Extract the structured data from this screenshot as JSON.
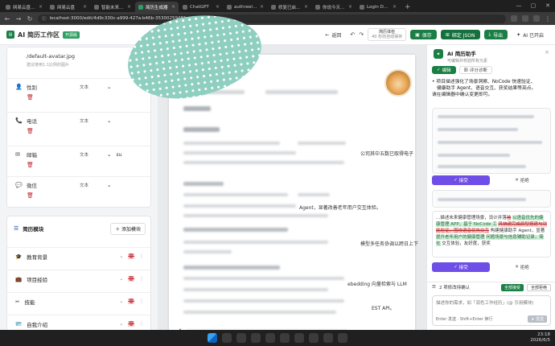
{
  "browser": {
    "tabs": [
      {
        "label": "网易云盘 · 我的",
        "active": false
      },
      {
        "label": "网易云盘",
        "active": false
      },
      {
        "label": "智能未来·智能招聘",
        "active": false
      },
      {
        "label": "简历生成器",
        "active": true
      },
      {
        "label": "ChatGPT",
        "active": false
      },
      {
        "label": "authreelcode.com",
        "active": false
      },
      {
        "label": "修复已启 · SJSON",
        "active": false
      },
      {
        "label": "你说今天就解决",
        "active": false
      },
      {
        "label": "Login Deep Control",
        "active": false
      }
    ],
    "new_tab": "+",
    "url": "localhost:3000/edit/4d9c330c-a999-427a-b46b-35300259481",
    "window_controls": [
      "—",
      "▢",
      "✕"
    ]
  },
  "header": {
    "logo_text": "AI 简历工作区",
    "badge": "开源版",
    "back_label": "返回",
    "theme_pill": [
      "简历体检",
      "40 秒前自动保存"
    ],
    "save_label": "保存",
    "json_label": "绑定 JSON",
    "export_label": "导出",
    "ai_label": "AI 已开启"
  },
  "left": {
    "avatar_value": "/default-avatar.jpg",
    "avatar_hint": "建议使用1:1比例的图片",
    "fields": [
      {
        "icon": "user-icon",
        "label": "性别",
        "type": "文本",
        "value": ""
      },
      {
        "icon": "phone-icon",
        "label": "电话",
        "type": "文本",
        "value": ""
      },
      {
        "icon": "mail-icon",
        "label": "邮箱",
        "type": "文本",
        "value": "su"
      },
      {
        "icon": "wechat-icon",
        "label": "微信",
        "type": "文本",
        "value": ""
      }
    ],
    "modules_title": "简历模块",
    "add_module": "添加模块",
    "modules": [
      {
        "icon": "graduation-icon",
        "label": "教育背景"
      },
      {
        "icon": "briefcase-icon",
        "label": "项目经验"
      },
      {
        "icon": "tools-icon",
        "label": "技能"
      },
      {
        "icon": "person-card-icon",
        "label": "自我介绍"
      }
    ]
  },
  "doc": {
    "snippets": [
      "公司其中五数已取得电子",
      "Agent，显著改善老年用户交互体验。",
      "模型多任务协调以跨日上下",
      "ebedding 向量检索与 LLM",
      "EST API。",
      "A",
      "果"
    ]
  },
  "assistant": {
    "title": "AI 简历助手",
    "subtitle": "可编辑并校验所有元素",
    "tabs": [
      "编辑",
      "评分诊断"
    ],
    "message_lines": [
      "项目描述强化了场景洞察、NoCode 快速验证、",
      "健康助手 Agent、语音交互、获奖结果等亮点。",
      "请在编辑器中确认变更即可。"
    ],
    "accept_label": "接受",
    "reject_label": "拒绝",
    "diff_text": {
      "a": "...描述未来健康管理场景，设计并落",
      "b": "地",
      "c": "以语音优先的健康管理 APP，基于 NoCode 工",
      "d": "具快速完成原型搭建与功能验证，围绕语音优先交互",
      "e": "构建健康助手 Agent，显著",
      "f": "提升老年用户的健康管理",
      "g": "问题场景与信息辅助记录，简化",
      "h": "交互体验，友好度，获奖"
    },
    "pending_label": "2 项修改待确认",
    "accept_all": "全部接受",
    "reject_all": "全部拒绝",
    "chat_placeholder": "描述你的需求，如「润色工作经历」(@ 引用模块)",
    "chat_hint": "Enter 发送 · Shift+Enter 换行",
    "send_label": "发送"
  },
  "taskbar": {
    "time": "23:18",
    "date": "2026/6/5"
  }
}
